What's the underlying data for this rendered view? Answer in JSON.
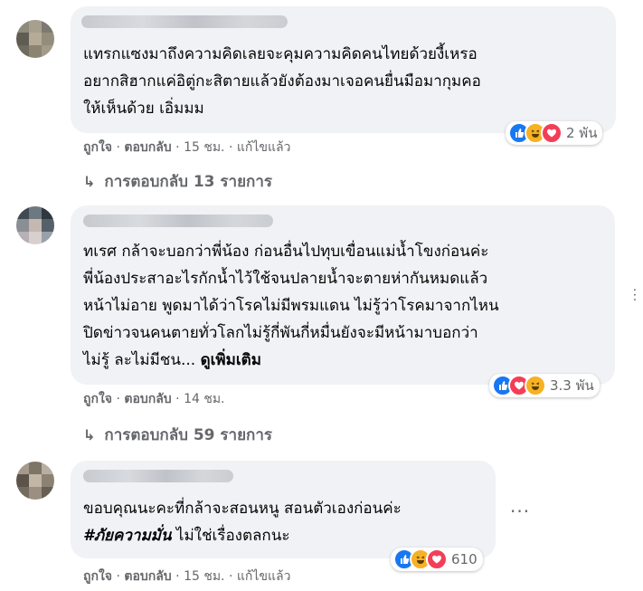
{
  "comments": [
    {
      "lines": [
        "แทรกแซงมาถึงความคิดเลยจะคุมความคิดคนไทยด้วยงี้เหรอ",
        "อยากสิฮากแค่อิตู่กะสิตายแล้วยังต้องมาเจอคนยื่นมือมากุมคอ",
        "ให้เห็นด้วย เอิ่มมม"
      ],
      "reaction_count": "2 พัน",
      "like": "ถูกใจ",
      "reply": "ตอบกลับ",
      "time": "15 ชม.",
      "edited": "แก้ไขแล้ว",
      "replies_label": "การตอบกลับ 13 รายการ"
    },
    {
      "lines": [
        "ทเรศ กล้าจะบอกว่าพี่น้อง ก่อนอื่นไปทุบเขื่อนแม่น้ำโขงก่อนค่ะ",
        "พี่น้องประสาอะไรกักน้ำไว้ใช้จนปลายน้ำจะตายห่ากันหมดแล้ว",
        "หน้าไม่อาย พูดมาได้ว่าโรคไม่มีพรมแดน ไม่รู้ว่าโรคมาจากไหน",
        "ปิดข่าวจนคนตายทั่วโลกไม่รู้กี่พันกี่หมื่นยังจะมีหน้ามาบอกว่า"
      ],
      "last_line_prefix": "ไม่รู้ ละไม่มีชน... ",
      "see_more": "ดูเพิ่มเติม",
      "reaction_count": "3.3 พัน",
      "like": "ถูกใจ",
      "reply": "ตอบกลับ",
      "time": "14 ชม.",
      "replies_label": "การตอบกลับ 59 รายการ"
    },
    {
      "line1": "ขอบคุณนะคะที่กล้าจะสอนหนู สอนตัวเองก่อนค่ะ",
      "hashtag": "#ภัยความมั่น",
      "line2_rest": " ไม่ใช่เรื่องตลกนะ",
      "reaction_count": "610",
      "like": "ถูกใจ",
      "reply": "ตอบกลับ",
      "time": "15 ชม.",
      "edited": "แก้ไขแล้ว"
    }
  ],
  "sep": " · ",
  "more_glyph": "···",
  "reply_arrow": "↳",
  "icons": [
    "like-icon",
    "haha-icon",
    "love-icon",
    "more-options-icon",
    "reply-arrow-icon"
  ],
  "colors": {
    "like": "#1877f2",
    "love": "#f33e58",
    "haha": "#f7b125",
    "bubble": "#f0f2f5",
    "meta": "#65676b"
  }
}
